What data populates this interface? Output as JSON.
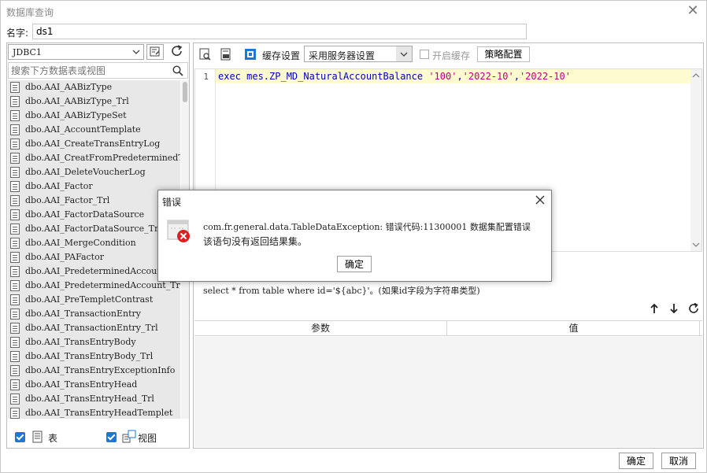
{
  "window": {
    "title": "数据库查询"
  },
  "name_field": {
    "label": "名字:",
    "value": "ds1"
  },
  "connection": {
    "selected": "JDBC1"
  },
  "search": {
    "placeholder": "搜索下方数据表或视图"
  },
  "tables": [
    "dbo.AAI_AABizType",
    "dbo.AAI_AABizType_Trl",
    "dbo.AAI_AABizTypeSet",
    "dbo.AAI_AccountTemplate",
    "dbo.AAI_CreateTransEntryLog",
    "dbo.AAI_CreatFromPredeterminedTem",
    "dbo.AAI_DeleteVoucherLog",
    "dbo.AAI_Factor",
    "dbo.AAI_Factor_Trl",
    "dbo.AAI_FactorDataSource",
    "dbo.AAI_FactorDataSource_Trl",
    "dbo.AAI_MergeCondition",
    "dbo.AAI_PAFactor",
    "dbo.AAI_PredeterminedAccount",
    "dbo.AAI_PredeterminedAccount_Trl",
    "dbo.AAI_PreTempletContrast",
    "dbo.AAI_TransactionEntry",
    "dbo.AAI_TransactionEntry_Trl",
    "dbo.AAI_TransEntryBody",
    "dbo.AAI_TransEntryBody_Trl",
    "dbo.AAI_TransEntryExceptionInfo",
    "dbo.AAI_TransEntryHead",
    "dbo.AAI_TransEntryHead_Trl",
    "dbo.AAI_TransEntryHeadTemplet"
  ],
  "left_footer": {
    "tables_label": "表",
    "views_label": "视图"
  },
  "toolbar": {
    "cache_label": "缓存设置",
    "cache_option": "采用服务器设置",
    "enable_cache_label": "开启缓存",
    "strategy_button": "策略配置"
  },
  "editor": {
    "line_number": "1",
    "code_prefix": "exec mes.ZP_MD_NaturalAccountBalance ",
    "arg1": "'100'",
    "sep1": ",",
    "arg2": "'2022-10'",
    "sep2": ",",
    "arg3": "'2022-10'"
  },
  "hint": "select * from table where id='${abc}'。(如果id字段为字符串类型)",
  "params": {
    "col_param": "参数",
    "col_value": "值"
  },
  "buttons": {
    "ok": "确定",
    "cancel": "取消"
  },
  "error_dialog": {
    "title": "错误",
    "message_line1": "com.fr.general.data.TableDataException: 错误代码:11300001 数据集配置错误",
    "message_line2": "该语句没有返回结果集。",
    "ok": "确定"
  },
  "colors": {
    "accent": "#1a78d6",
    "code_keyword": "#0000c8",
    "code_string": "#c0007a",
    "line_highlight": "#fffbd0",
    "error_red": "#e02020"
  }
}
